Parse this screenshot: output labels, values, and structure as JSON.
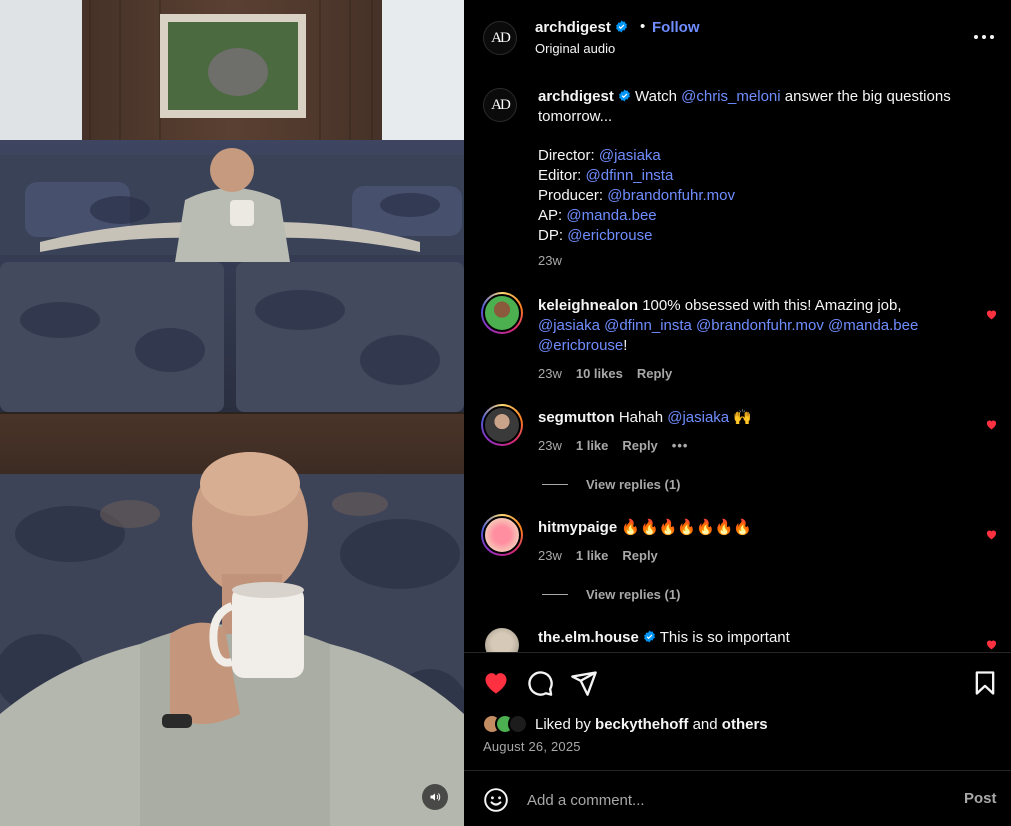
{
  "colors": {
    "accent": "#708dff",
    "like_red": "#ff3040",
    "muted": "#a8a8a8"
  },
  "media": {
    "mute_icon": "speaker-icon"
  },
  "header": {
    "username": "archdigest",
    "avatar_text": "AD",
    "separator": "•",
    "follow_label": "Follow",
    "audio_label": "Original audio"
  },
  "caption": {
    "username": "archdigest",
    "avatar_text": "AD",
    "text_1": "Watch ",
    "mention_1": "@chris_meloni",
    "text_2": " answer the big questions tomorrow...",
    "credits": [
      {
        "role": "Director: ",
        "handle": "@jasiaka"
      },
      {
        "role": "Editor: ",
        "handle": "@dfinn_insta"
      },
      {
        "role": "Producer: ",
        "handle": "@brandonfuhr.mov"
      },
      {
        "role": "AP: ",
        "handle": "@manda.bee"
      },
      {
        "role": "DP: ",
        "handle": "@ericbrouse"
      }
    ],
    "time": "23w"
  },
  "comments": [
    {
      "username": "keleighnealon",
      "text": " 100% obsessed with this! Amazing job,",
      "mentions": [
        "@jasiaka",
        "@dfinn_insta",
        "@brandonfuhr.mov",
        "@manda.bee",
        "@ericbrouse"
      ],
      "suffix": "!",
      "time": "23w",
      "likes": "10 likes",
      "reply": "Reply"
    },
    {
      "username": "segmutton",
      "text": " Hahah ",
      "mention": "@jasiaka",
      "emoji": " 🙌",
      "time": "23w",
      "likes": "1 like",
      "reply": "Reply",
      "more": "•••",
      "view_replies": "View replies (1)"
    },
    {
      "username": "hitmypaige",
      "emoji": " 🔥🔥🔥🔥🔥🔥🔥",
      "time": "23w",
      "likes": "1 like",
      "reply": "Reply",
      "view_replies": "View replies (1)"
    },
    {
      "username": "the.elm.house",
      "text": " This is so important"
    }
  ],
  "liked": {
    "prefix": "Liked by ",
    "user": "beckythehoff",
    "middle": " and ",
    "others": "others"
  },
  "date": "August 26, 2025",
  "comment_bar": {
    "placeholder": "Add a comment...",
    "post_label": "Post"
  }
}
